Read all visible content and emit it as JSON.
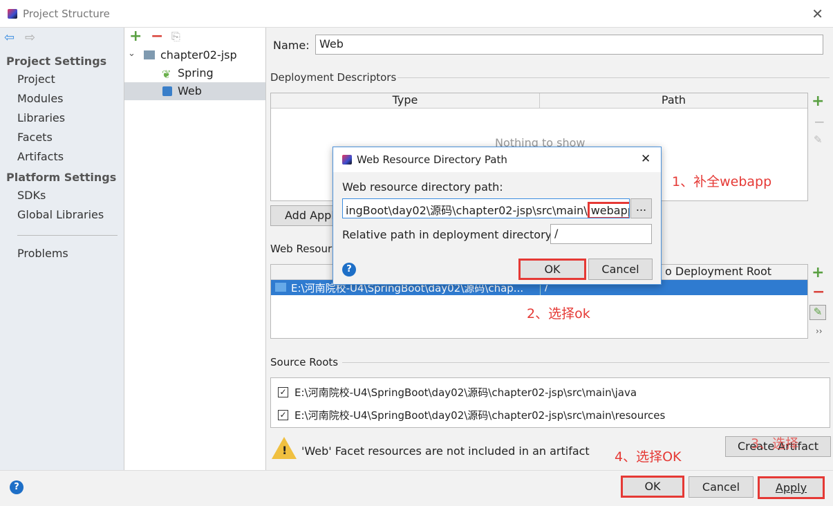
{
  "window": {
    "title": "Project Structure"
  },
  "sidebar": {
    "sections": [
      {
        "label": "Project Settings",
        "items": [
          "Project",
          "Modules",
          "Libraries",
          "Facets",
          "Artifacts"
        ]
      },
      {
        "label": "Platform Settings",
        "items": [
          "SDKs",
          "Global Libraries"
        ]
      }
    ],
    "problems": "Problems"
  },
  "tree": {
    "root": "chapter02-jsp",
    "children": [
      "Spring",
      "Web"
    ],
    "selected": "Web"
  },
  "main": {
    "name_label": "Name:",
    "name_value": "Web",
    "deployment_descriptors": "Deployment Descriptors",
    "dd_columns": [
      "Type",
      "Path"
    ],
    "dd_empty": "Nothing to show",
    "add_button": "Add Appl",
    "web_resource_label": "Web Resour",
    "wr_column2": "o Deployment Root",
    "wr_row": {
      "path": "E:\\河南院校-U4\\SpringBoot\\day02\\源码\\chap...",
      "root": "/"
    },
    "source_roots": "Source Roots",
    "source_items": [
      "E:\\河南院校-U4\\SpringBoot\\day02\\源码\\chapter02-jsp\\src\\main\\java",
      "E:\\河南院校-U4\\SpringBoot\\day02\\源码\\chapter02-jsp\\src\\main\\resources"
    ],
    "warning": "'Web' Facet resources are not included in an artifact",
    "create_artifact": "Create Artifact"
  },
  "dialog": {
    "title": "Web Resource Directory Path",
    "path_label": "Web resource directory path:",
    "path_value": "ingBoot\\day02\\源码\\chapter02-jsp\\src\\main\\",
    "path_highlight": "webapp",
    "browse": "...",
    "relative_label": "Relative path in deployment directory:",
    "relative_value": "/",
    "ok": "OK",
    "cancel": "Cancel",
    "help": "?"
  },
  "footer": {
    "help": "?",
    "ok": "OK",
    "cancel": "Cancel",
    "apply": "Apply"
  },
  "annotations": [
    "1、补全webapp",
    "2、选择ok",
    "3、选择",
    "4、选择OK"
  ],
  "colors": {
    "selection": "#2f7bd0",
    "annotation": "#e53935",
    "add": "#5aa042"
  }
}
